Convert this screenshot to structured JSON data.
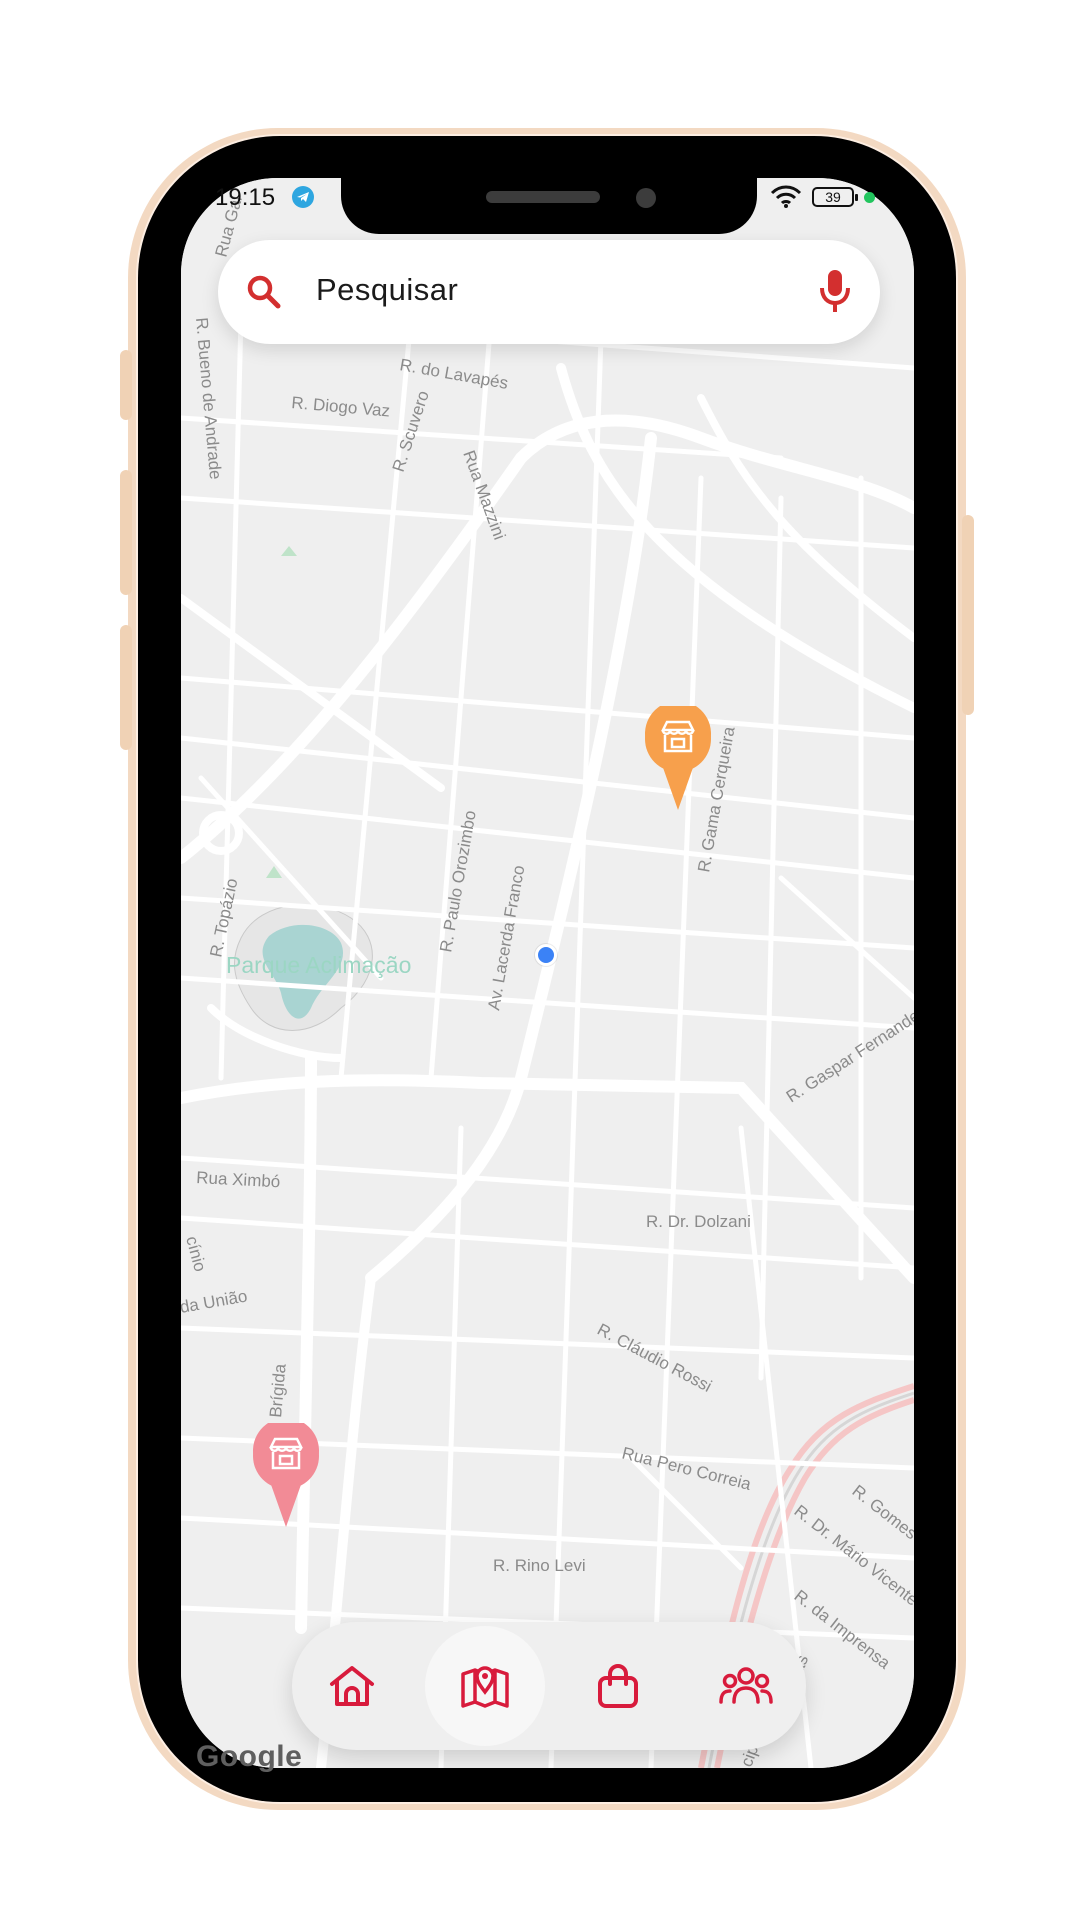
{
  "status_bar": {
    "time": "19:15",
    "battery": "39"
  },
  "search": {
    "placeholder": "Pesquisar"
  },
  "map": {
    "streets": [
      "R. do Lavapés",
      "R. Diogo Vaz",
      "R. Scuvero",
      "Rua Mazzini",
      "R. Bueno de Andrade",
      "Rua Gal",
      "R. Topázio",
      "Parque Aclimação",
      "R. Paulo Orozimbo",
      "Av. Lacerda Franco",
      "R. Gama Cerqueira",
      "R. Gaspar Fernandes",
      "Rua Ximbó",
      "R. Dr. Dolzani",
      "da União",
      "cínio",
      "R. Cláudio Rossi",
      "Rua Pero Correia",
      "Brígida",
      "R. Rino Levi",
      "R. Gomes",
      "R. Dr. Mário Vicente",
      "R. da Imprensa",
      "ias",
      "cip"
    ],
    "provider": "Google"
  },
  "markers": [
    {
      "type": "store",
      "color": "#f7a04c",
      "icon": "store-icon"
    },
    {
      "type": "store",
      "color": "#f28b96",
      "icon": "store-icon"
    }
  ],
  "user_location": {
    "color": "#3b82f6"
  },
  "bottom_nav": {
    "items": [
      {
        "id": "home",
        "icon": "home-icon",
        "active": false
      },
      {
        "id": "map",
        "icon": "map-pin-icon",
        "active": true
      },
      {
        "id": "shop",
        "icon": "shopping-bag-icon",
        "active": false
      },
      {
        "id": "community",
        "icon": "users-icon",
        "active": false
      }
    ],
    "accent": "#d81b3c"
  }
}
